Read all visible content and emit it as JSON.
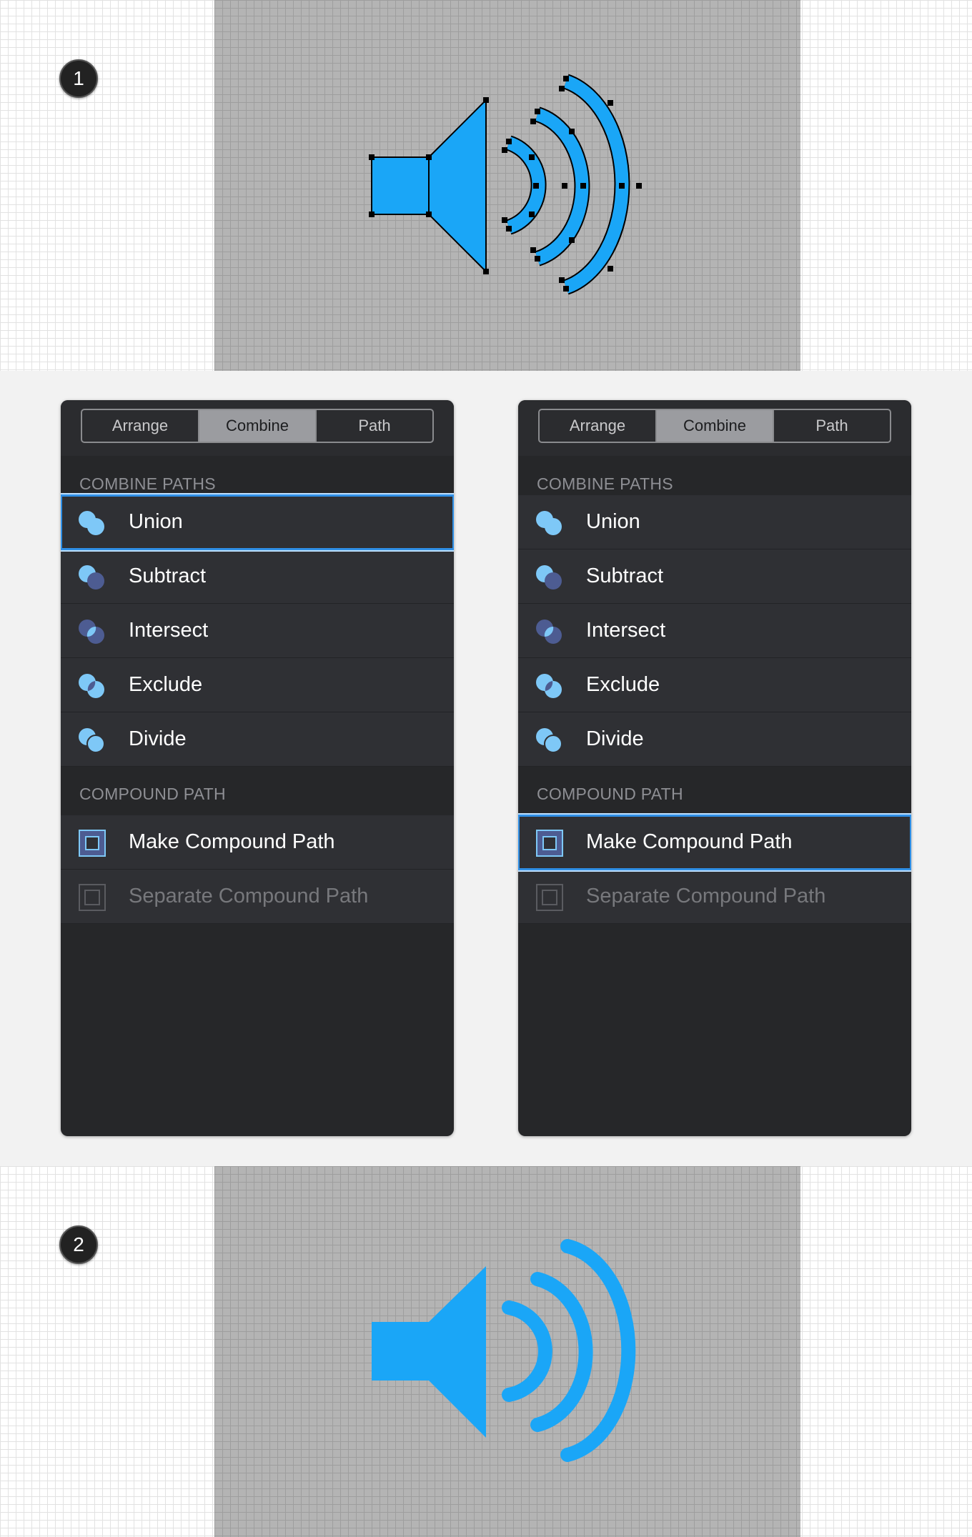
{
  "steps": {
    "first": "1",
    "second": "2"
  },
  "colors": {
    "shape_fill": "#1aa6f7",
    "panel_bg": "#262729",
    "row_bg": "#2f3034",
    "selection": "#2f8fe6",
    "icon_light": "#7ec8f7",
    "icon_dark": "#4d5c92"
  },
  "panels": [
    {
      "tabs": [
        "Arrange",
        "Combine",
        "Path"
      ],
      "active_tab": "Combine",
      "combine_header": "COMBINE PATHS",
      "combine_items": [
        {
          "label": "Union",
          "icon": "union-icon",
          "selected": true
        },
        {
          "label": "Subtract",
          "icon": "subtract-icon"
        },
        {
          "label": "Intersect",
          "icon": "intersect-icon"
        },
        {
          "label": "Exclude",
          "icon": "exclude-icon"
        },
        {
          "label": "Divide",
          "icon": "divide-icon"
        }
      ],
      "compound_header": "COMPOUND PATH",
      "compound_items": [
        {
          "label": "Make Compound Path",
          "icon": "make-compound-icon"
        },
        {
          "label": "Separate Compound Path",
          "icon": "separate-compound-icon",
          "disabled": true
        }
      ]
    },
    {
      "tabs": [
        "Arrange",
        "Combine",
        "Path"
      ],
      "active_tab": "Combine",
      "combine_header": "COMBINE PATHS",
      "combine_items": [
        {
          "label": "Union",
          "icon": "union-icon"
        },
        {
          "label": "Subtract",
          "icon": "subtract-icon"
        },
        {
          "label": "Intersect",
          "icon": "intersect-icon"
        },
        {
          "label": "Exclude",
          "icon": "exclude-icon"
        },
        {
          "label": "Divide",
          "icon": "divide-icon"
        }
      ],
      "compound_header": "COMPOUND PATH",
      "compound_items": [
        {
          "label": "Make Compound Path",
          "icon": "make-compound-icon",
          "selected": true
        },
        {
          "label": "Separate Compound Path",
          "icon": "separate-compound-icon",
          "disabled": true
        }
      ]
    }
  ]
}
